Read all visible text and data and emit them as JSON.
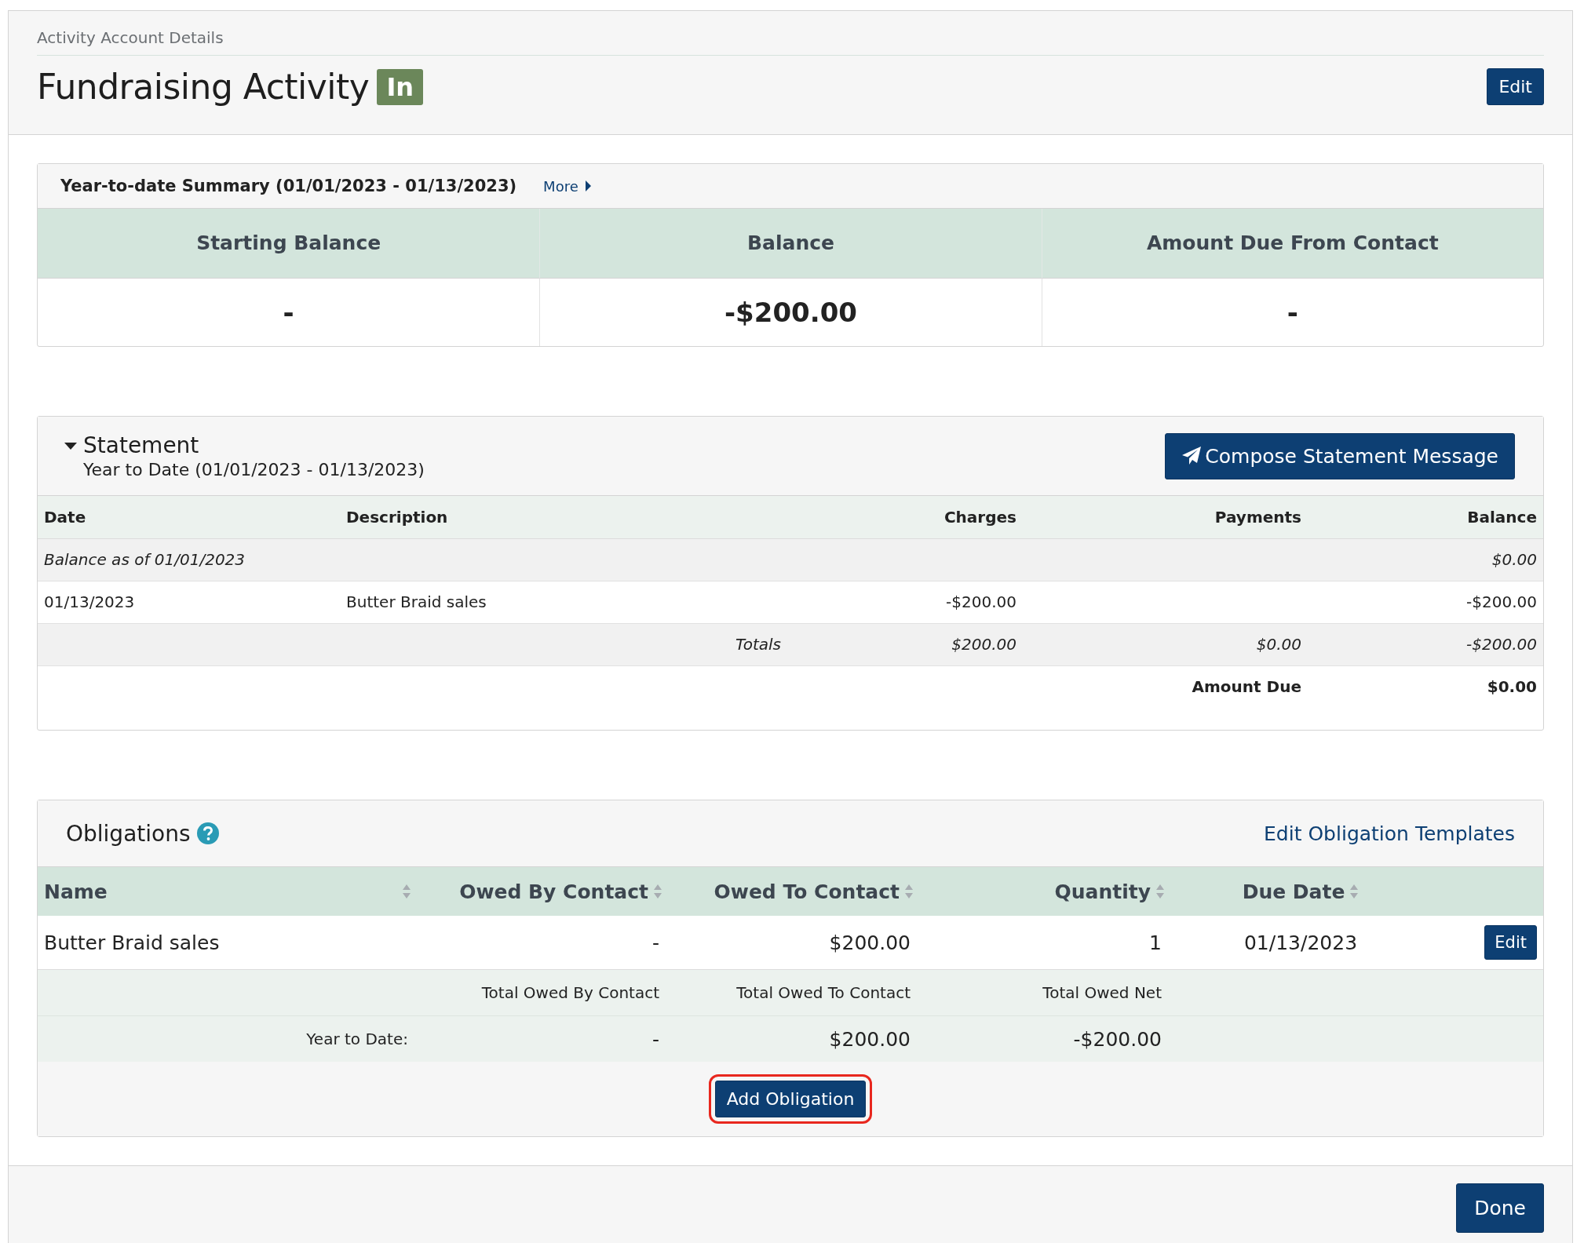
{
  "header": {
    "breadcrumb": "Activity Account Details",
    "title": "Fundraising Activity",
    "badge": "In",
    "edit_button": "Edit"
  },
  "summary": {
    "title": "Year-to-date Summary (01/01/2023 - 01/13/2023)",
    "more_link": "More",
    "columns": [
      "Starting Balance",
      "Balance",
      "Amount Due From Contact"
    ],
    "values": [
      "-",
      "-$200.00",
      "-"
    ]
  },
  "statement": {
    "expanded": true,
    "title": "Statement",
    "subtitle": "Year to Date (01/01/2023 - 01/13/2023)",
    "compose_button": "Compose Statement Message",
    "columns": [
      "Date",
      "Description",
      "Charges",
      "Payments",
      "Balance"
    ],
    "rows": [
      {
        "kind": "opening",
        "cells": [
          "Balance as of 01/01/2023",
          "",
          "",
          "",
          "$0.00"
        ]
      },
      {
        "kind": "entry",
        "cells": [
          "01/13/2023",
          "Butter Braid sales",
          "-$200.00",
          "",
          "-$200.00"
        ]
      },
      {
        "kind": "totals",
        "cells": [
          "",
          "Totals",
          "$200.00",
          "$0.00",
          "-$200.00"
        ]
      },
      {
        "kind": "due",
        "cells": [
          "",
          "",
          "",
          "Amount Due",
          "$0.00"
        ]
      }
    ]
  },
  "obligations": {
    "title": "Obligations",
    "templates_link": "Edit Obligation Templates",
    "columns": [
      "Name",
      "Owed By Contact",
      "Owed To Contact",
      "Quantity",
      "Due Date"
    ],
    "rows": [
      {
        "cells": [
          "Butter Braid sales",
          "-",
          "$200.00",
          "1",
          "01/13/2023"
        ],
        "edit_button": "Edit"
      }
    ],
    "totals_labels": [
      "Total Owed By Contact",
      "Total Owed To Contact",
      "Total Owed Net"
    ],
    "totals_row": {
      "label": "Year to Date:",
      "values": [
        "-",
        "$200.00",
        "-$200.00"
      ]
    },
    "add_button": {
      "label": "Add Obligation",
      "highlighted": true
    }
  },
  "footer": {
    "done_button": "Done"
  }
}
